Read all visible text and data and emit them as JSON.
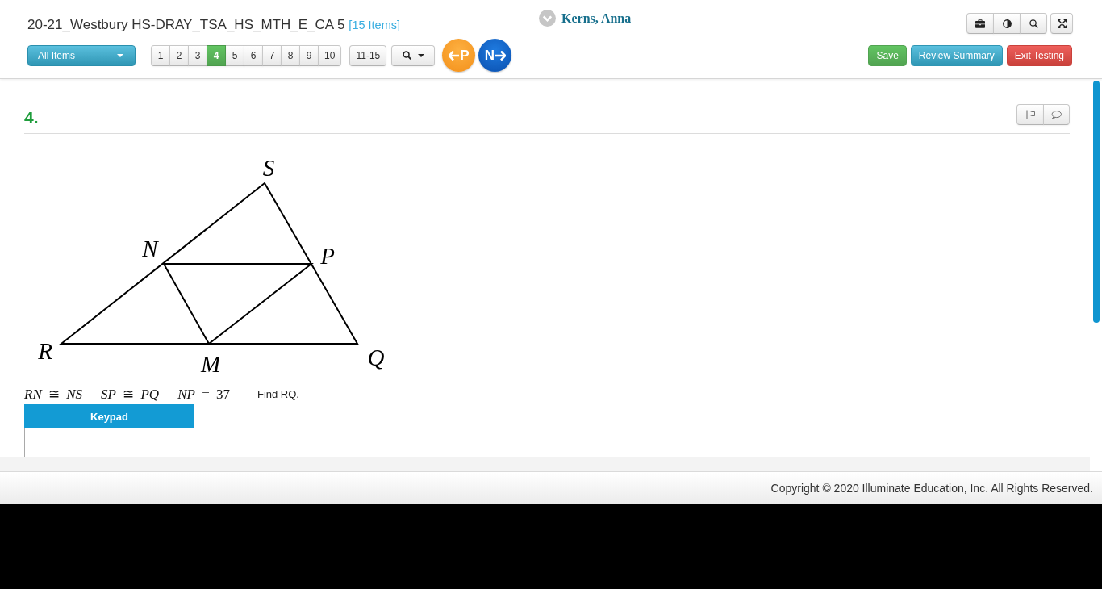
{
  "header": {
    "title": "20-21_Westbury HS-DRAY_TSA_HS_MTH_E_CA 5",
    "item_count": "[15 Items]",
    "user_name": "Kerns, Anna"
  },
  "toolbar": {
    "item_filter": "All Items",
    "pages": [
      {
        "label": "1",
        "selected": false
      },
      {
        "label": "2",
        "selected": false
      },
      {
        "label": "3",
        "selected": false
      },
      {
        "label": "4",
        "selected": true
      },
      {
        "label": "5",
        "selected": false
      },
      {
        "label": "6",
        "selected": false
      },
      {
        "label": "7",
        "selected": false
      },
      {
        "label": "8",
        "selected": false
      },
      {
        "label": "9",
        "selected": false
      },
      {
        "label": "10",
        "selected": false
      }
    ],
    "page_range": "11-15",
    "previous_button": "P",
    "next_button": "N",
    "actions": [
      {
        "label": "Save",
        "kind": "save"
      },
      {
        "label": "Review Summary",
        "kind": "review"
      },
      {
        "label": "Exit Testing",
        "kind": "exit"
      }
    ]
  },
  "question": {
    "number": "4.",
    "figure": {
      "vertex_labels": [
        "S",
        "N",
        "P",
        "R",
        "M",
        "Q"
      ]
    },
    "givens": [
      "*RN* ≅ *NS*",
      "*SP* ≅ *PQ*",
      "*NP* = 37"
    ],
    "prompt": "Find RQ.",
    "keypad": {
      "title": "Keypad"
    }
  },
  "footer": {
    "copyright": "Copyright © 2020 Illuminate Education, Inc. All Rights Reserved."
  }
}
